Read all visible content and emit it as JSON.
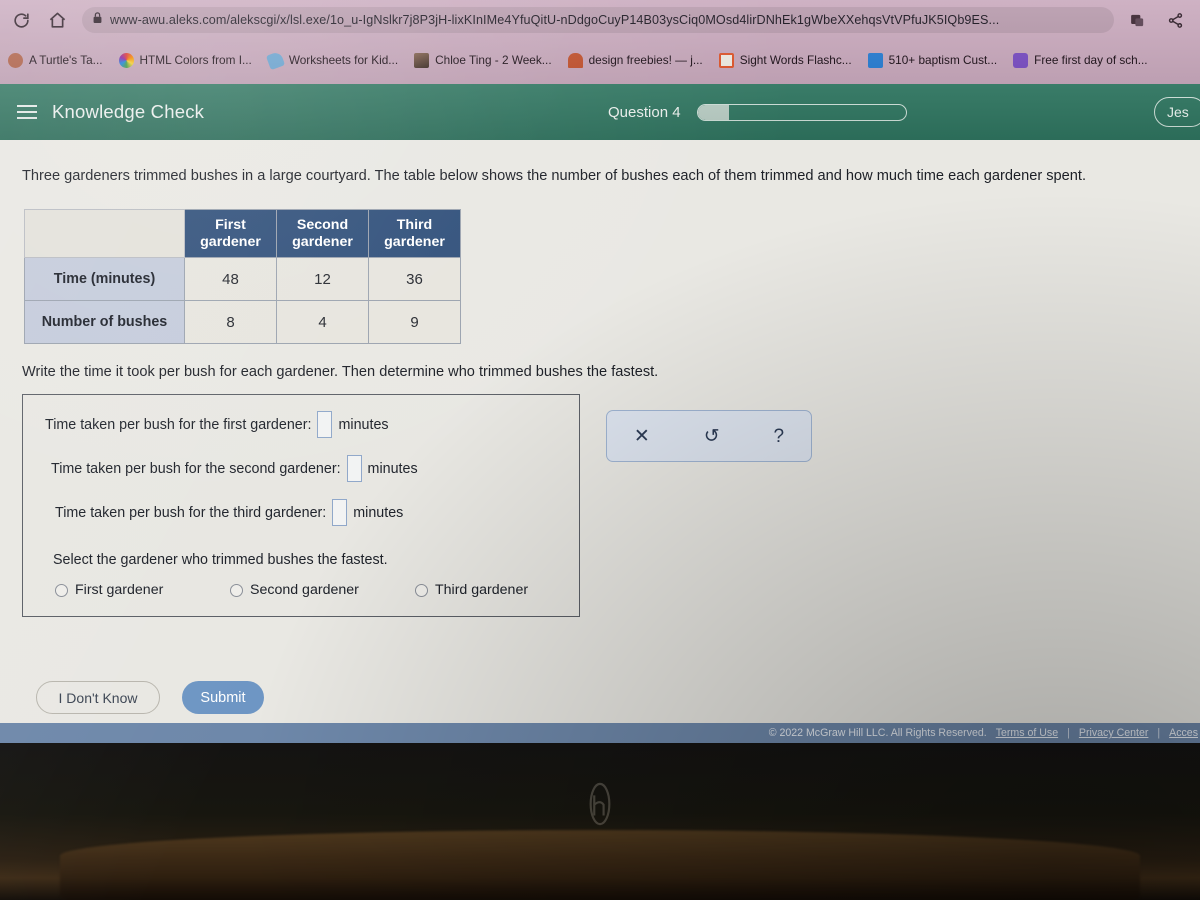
{
  "browser": {
    "url": "www-awu.aleks.com/alekscgi/x/lsl.exe/1o_u-IgNslkr7j8P3jH-lixKInIMe4YfuQitU-nDdgoCuyP14B03ysCiq0MOsd4lirDNhEk1gWbeXXehqsVtVPfuJK5IQb9ES...",
    "reload_icon": "reload-icon",
    "home_icon": "home-icon",
    "lock_icon": "lock-icon",
    "share_icon": "share-icon",
    "extension_icon": "extension-icon",
    "bookmarks": [
      {
        "label": "A Turtle's Ta...",
        "icon": "favicon-turtle",
        "color": "#b5654b"
      },
      {
        "label": "HTML Colors from I...",
        "icon": "favicon-colorwheel",
        "color": "#e7e7e7"
      },
      {
        "label": "Worksheets for Kid...",
        "icon": "favicon-tag",
        "color": "#6ea9d6"
      },
      {
        "label": "Chloe Ting - 2 Week...",
        "icon": "favicon-photo",
        "color": "#5b4236"
      },
      {
        "label": "design freebies! — j...",
        "icon": "favicon-arch",
        "color": "#c4512c"
      },
      {
        "label": "Sight Words Flashc...",
        "icon": "favicon-card",
        "color": "#e2572c"
      },
      {
        "label": "510+ baptism Cust...",
        "icon": "favicon-blue",
        "color": "#2a7fd4"
      },
      {
        "label": "Free first day of sch...",
        "icon": "favicon-purple",
        "color": "#7b4fc4"
      }
    ]
  },
  "app": {
    "menu_icon": "hamburger-menu-icon",
    "title": "Knowledge Check",
    "question_label": "Question 4",
    "progress_percent": 15,
    "user_badge": "Jes",
    "header_color": "#2f7560"
  },
  "question": {
    "prompt": "Three gardeners trimmed bushes in a large courtyard. The table below shows the number of bushes each of them trimmed and how much time each gardener spent.",
    "subprompt": "Write the time it took per bush for each gardener. Then determine who trimmed bushes the fastest."
  },
  "table": {
    "corner": "",
    "columns": [
      "First gardener",
      "Second gardener",
      "Third gardener"
    ],
    "rows": [
      {
        "header": "Time (minutes)",
        "values": [
          "48",
          "12",
          "36"
        ]
      },
      {
        "header": "Number of bushes",
        "values": [
          "8",
          "4",
          "9"
        ]
      }
    ],
    "header_color": "#2f4f7a"
  },
  "answer": {
    "lines": [
      {
        "pre": "Time taken per bush for the first gardener:",
        "value": "",
        "post": "minutes"
      },
      {
        "pre": "Time taken per bush for the second gardener:",
        "value": "",
        "post": "minutes"
      },
      {
        "pre": "Time taken per bush for the third gardener:",
        "value": "",
        "post": "minutes"
      }
    ],
    "select_label": "Select the gardener who trimmed bushes the fastest.",
    "options": [
      "First gardener",
      "Second gardener",
      "Third gardener"
    ],
    "selected": ""
  },
  "tools": {
    "clear_icon": "✕",
    "undo_icon": "↺",
    "help_icon": "?"
  },
  "buttons": {
    "dont_know": "I Don't Know",
    "submit": "Submit"
  },
  "footer": {
    "copyright": "© 2022 McGraw Hill LLC. All Rights Reserved.",
    "terms": "Terms of Use",
    "privacy": "Privacy Center",
    "accessibility": "Acces"
  },
  "device": {
    "brand_logo": "hp-logo"
  }
}
